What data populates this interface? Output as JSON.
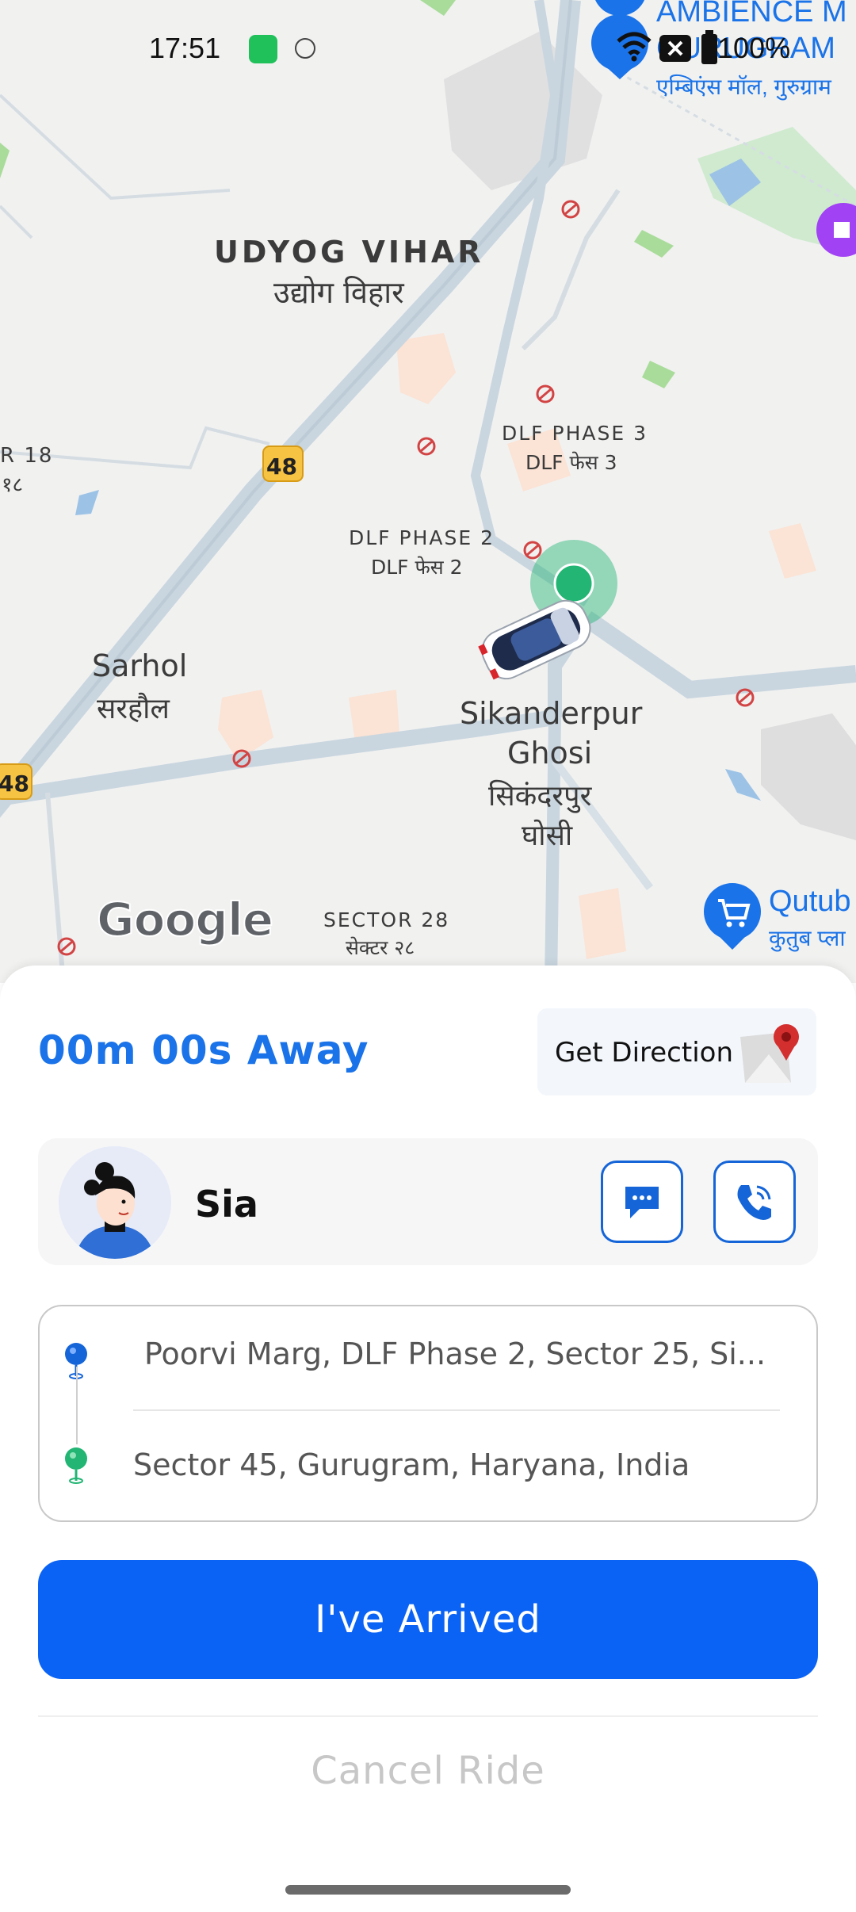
{
  "status_bar": {
    "time": "17:51",
    "battery": "100%"
  },
  "map": {
    "labels": {
      "udyog_en": "UDYOG VIHAR",
      "udyog_hi": "उद्योग विहार",
      "dlf3_en": "DLF PHASE 3",
      "dlf3_hi": "DLF फेस 3",
      "dlf2_en": "DLF PHASE 2",
      "dlf2_hi": "DLF फेस 2",
      "sarhol_en": "Sarhol",
      "sarhol_hi": "सरहौल",
      "sikanderpur_en_1": "Sikanderpur",
      "sikanderpur_en_2": "Ghosi",
      "sikanderpur_hi_1": "सिकंदरपुर",
      "sikanderpur_hi_2": "घोसी",
      "sector18_en": "R 18",
      "sector18_hi": "१८",
      "sector28_en": "SECTOR 28",
      "sector28_hi": "सेक्टर २८",
      "ambience_en_1": "AMBIENCE M",
      "ambience_en_2": "GURUGRAM",
      "ambience_hi": "एम्बिएंस मॉल, गुरुग्राम",
      "qutub_en": "Qutub",
      "qutub_hi": "कुतुब प्ला",
      "highway_1": "48",
      "highway_2": "48",
      "google": "Google"
    }
  },
  "trip": {
    "eta": "00m 00s Away",
    "get_direction": "Get Direction",
    "driver_name": "Sia",
    "pickup": "Poorvi Marg, DLF Phase 2, Sector 25, Si...",
    "drop": "Sector 45, Gurugram, Haryana, India",
    "arrived_label": "I've Arrived",
    "cancel_label": "Cancel Ride"
  },
  "colors": {
    "accent": "#1a73e8",
    "primary_button": "#0a63f5",
    "location_dot": "#22b573"
  }
}
